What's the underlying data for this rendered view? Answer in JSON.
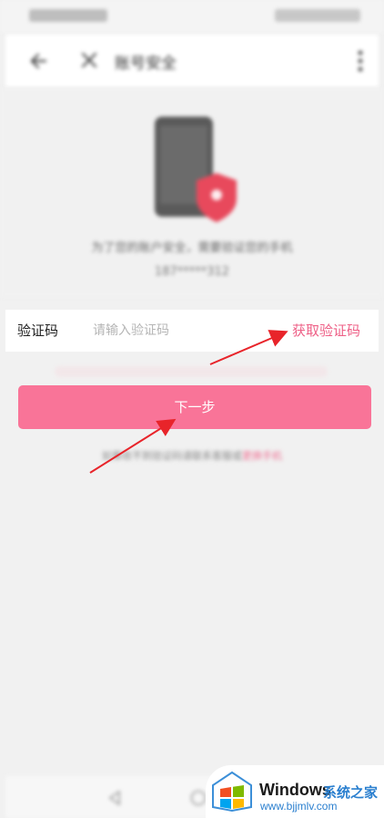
{
  "nav": {
    "title": "账号安全"
  },
  "header": {
    "info": "为了您的账户安全，需要验证您的手机",
    "phone_masked": "187*****312"
  },
  "verification": {
    "label": "验证码",
    "placeholder": "请输入验证码",
    "get_code_label": "获取验证码"
  },
  "next_button": {
    "label": "下一步"
  },
  "note": {
    "text": "如果收不到验证码请联系客服或",
    "link": "更换手机"
  },
  "watermark": {
    "brand": "Windows",
    "brand_cn": "系统之家",
    "url": "www.bjjmlv.com"
  },
  "colors": {
    "accent": "#f97498",
    "link": "#ee5f86",
    "arrow": "#e8242a"
  }
}
